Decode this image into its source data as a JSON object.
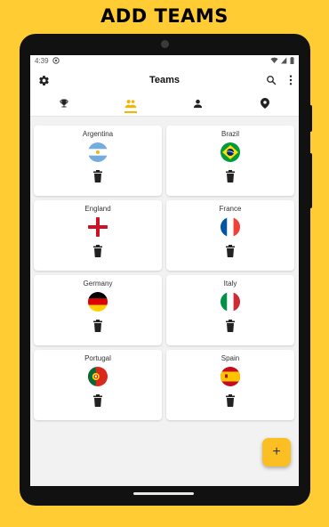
{
  "headline": "ADD TEAMS",
  "status_bar": {
    "time": "4:39"
  },
  "app_bar": {
    "title": "Teams",
    "left_icon": "gear-icon",
    "right_icons": [
      "search-icon",
      "more-vert-icon"
    ]
  },
  "tabs": [
    {
      "icon": "trophy-icon",
      "active": false
    },
    {
      "icon": "group-icon",
      "active": true
    },
    {
      "icon": "person-icon",
      "active": false
    },
    {
      "icon": "location-pin-icon",
      "active": false
    }
  ],
  "teams": [
    {
      "name": "Argentina",
      "flag": "argentina"
    },
    {
      "name": "Brazil",
      "flag": "brazil"
    },
    {
      "name": "England",
      "flag": "england"
    },
    {
      "name": "France",
      "flag": "france"
    },
    {
      "name": "Germany",
      "flag": "germany"
    },
    {
      "name": "Italy",
      "flag": "italy"
    },
    {
      "name": "Portugal",
      "flag": "portugal"
    },
    {
      "name": "Spain",
      "flag": "spain"
    }
  ],
  "fab": {
    "label": "+"
  },
  "colors": {
    "background": "#FFCC33",
    "accent": "#f4b400",
    "fab": "#fbbf24"
  }
}
